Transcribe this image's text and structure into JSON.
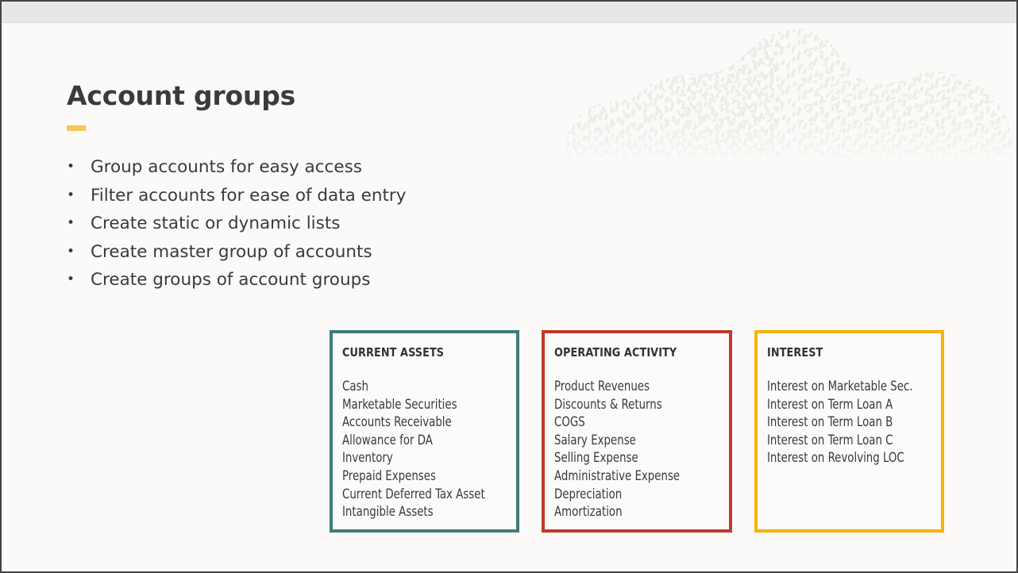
{
  "slide": {
    "background_color": "#fbfaf8",
    "top_bar_color": "#e8e7e5",
    "border_color": "#434343"
  },
  "title": {
    "text": "Account groups",
    "color": "#3b3b3a",
    "accent_color": "#f5c75c"
  },
  "bullets": [
    {
      "marker": "•",
      "text": "Group accounts for easy access"
    },
    {
      "marker": "•",
      "text": "Filter accounts for ease of data entry"
    },
    {
      "marker": "•",
      "text": "Create static or dynamic lists"
    },
    {
      "marker": "•",
      "text": "Create master group of accounts"
    },
    {
      "marker": "•",
      "text": "Create groups of account groups"
    }
  ],
  "category_boxes": [
    {
      "title": "CURRENT ASSETS",
      "border_color": "#3d7d79",
      "items": [
        "Cash",
        "Marketable Securities",
        "Accounts Receivable",
        "Allowance for DA",
        "Inventory",
        "Prepaid Expenses",
        "Current Deferred Tax Asset",
        "Intangible Assets"
      ]
    },
    {
      "title": "OPERATING ACTIVITY",
      "border_color": "#c0392b",
      "items": [
        "Product Revenues",
        "Discounts & Returns",
        "COGS",
        "Salary Expense",
        "Selling Expense",
        "Administrative Expense",
        "Depreciation",
        "Amortization"
      ]
    },
    {
      "title": "INTEREST",
      "border_color": "#f5b301",
      "items": [
        "Interest on Marketable Sec.",
        "Interest on Term Loan A",
        "Interest on Term Loan B",
        "Interest on Term Loan C",
        "Interest on Revolving LOC"
      ]
    }
  ],
  "decoration": {
    "name": "textured-cloud-graphic",
    "color": "#ebeae7"
  }
}
